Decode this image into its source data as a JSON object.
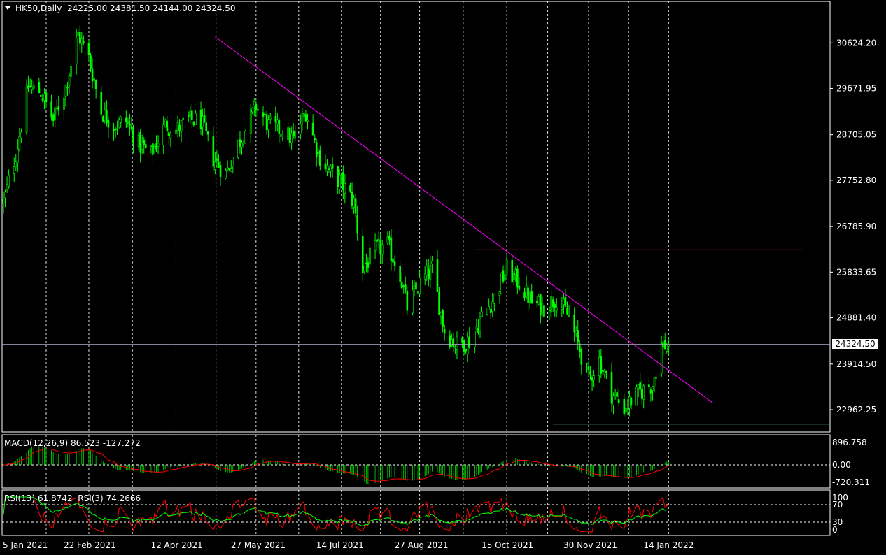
{
  "header": {
    "symbol": "HK50,Daily",
    "ohlc": "24225.00 24381.50 24144.00 24324.50"
  },
  "current_price_label": "24324.50",
  "macd_panel": {
    "title": "MACD(12,26,9)",
    "values": "86.523 -127.272",
    "axis_labels": [
      "896.758",
      "0.00",
      "-720.311"
    ]
  },
  "rsi_panel": {
    "title1": "RSI(13)",
    "value1": "61.8742",
    "title2": "RSI(3)",
    "value2": "74.2666",
    "axis_labels": [
      "100",
      "70",
      "30",
      "0"
    ]
  },
  "colors": {
    "background": "#000000",
    "candle": "#00ff00",
    "trendline": "#ff00ff",
    "resistance": "#ff3030",
    "support": "#4fb0b0",
    "macd_signal": "#ff0000",
    "grid": "#ffffff"
  },
  "chart_data": {
    "type": "candlestick",
    "price_axis": {
      "ticks": [
        "30624.20",
        "29671.95",
        "28705.05",
        "27752.80",
        "26785.90",
        "25833.65",
        "24881.40",
        "23914.50",
        "22962.25"
      ],
      "range": [
        22350,
        31350
      ]
    },
    "date_axis": {
      "ticks": [
        "5 Jan 2021",
        "22 Feb 2021",
        "12 Apr 2021",
        "27 May 2021",
        "14 Jul 2021",
        "27 Aug 2021",
        "15 Oct 2021",
        "30 Nov 2021",
        "14 Jan 2022"
      ]
    },
    "close_path": [
      [
        "2021-01-05",
        27300
      ],
      [
        "2021-01-12",
        28300
      ],
      [
        "2021-01-19",
        29700
      ],
      [
        "2021-01-26",
        29600
      ],
      [
        "2021-02-02",
        29000
      ],
      [
        "2021-02-09",
        29700
      ],
      [
        "2021-02-16",
        30800
      ],
      [
        "2021-02-22",
        30300
      ],
      [
        "2021-03-01",
        29200
      ],
      [
        "2021-03-08",
        28900
      ],
      [
        "2021-03-15",
        29000
      ],
      [
        "2021-03-22",
        28500
      ],
      [
        "2021-03-29",
        28300
      ],
      [
        "2021-04-06",
        28900
      ],
      [
        "2021-04-12",
        28800
      ],
      [
        "2021-04-19",
        29000
      ],
      [
        "2021-04-26",
        29000
      ],
      [
        "2021-05-03",
        28200
      ],
      [
        "2021-05-10",
        27900
      ],
      [
        "2021-05-17",
        28500
      ],
      [
        "2021-05-27",
        29300
      ],
      [
        "2021-06-03",
        28900
      ],
      [
        "2021-06-10",
        28800
      ],
      [
        "2021-06-17",
        28600
      ],
      [
        "2021-06-24",
        29200
      ],
      [
        "2021-07-01",
        28300
      ],
      [
        "2021-07-08",
        27900
      ],
      [
        "2021-07-14",
        27700
      ],
      [
        "2021-07-21",
        27300
      ],
      [
        "2021-07-26",
        25900
      ],
      [
        "2021-08-02",
        26300
      ],
      [
        "2021-08-09",
        26400
      ],
      [
        "2021-08-16",
        25800
      ],
      [
        "2021-08-20",
        25100
      ],
      [
        "2021-08-27",
        25600
      ],
      [
        "2021-09-03",
        25900
      ],
      [
        "2021-09-10",
        24600
      ],
      [
        "2021-09-17",
        24300
      ],
      [
        "2021-09-24",
        24400
      ],
      [
        "2021-10-01",
        24900
      ],
      [
        "2021-10-08",
        25300
      ],
      [
        "2021-10-15",
        25900
      ],
      [
        "2021-10-22",
        25600
      ],
      [
        "2021-10-29",
        25200
      ],
      [
        "2021-11-05",
        25100
      ],
      [
        "2021-11-12",
        25300
      ],
      [
        "2021-11-19",
        24900
      ],
      [
        "2021-11-26",
        24100
      ],
      [
        "2021-11-30",
        23600
      ],
      [
        "2021-12-06",
        24000
      ],
      [
        "2021-12-13",
        23300
      ],
      [
        "2021-12-20",
        23000
      ],
      [
        "2021-12-28",
        23300
      ],
      [
        "2022-01-05",
        23500
      ],
      [
        "2022-01-10",
        24300
      ],
      [
        "2022-01-14",
        24324.5
      ]
    ],
    "trendline": {
      "from": [
        "2021-05-04",
        30750
      ],
      "to": [
        "2022-02-08",
        23100
      ]
    },
    "resistance_level": {
      "value": 26300,
      "from": "2021-09-27",
      "to": "2022-03-31"
    },
    "support_level": {
      "value": 22660,
      "from": "2021-11-10",
      "to": "2022-03-31"
    },
    "current_price": 24324.5
  }
}
